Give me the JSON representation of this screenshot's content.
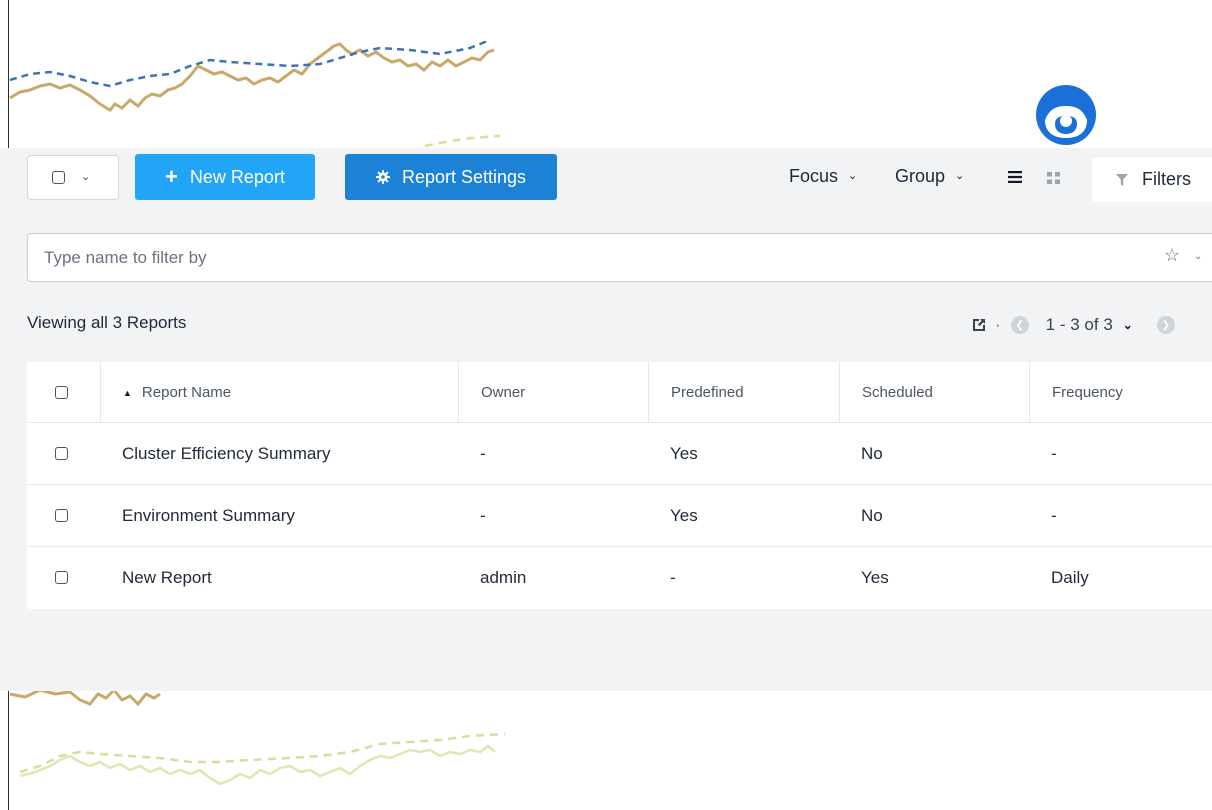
{
  "toolbar": {
    "new_report_label": "New Report",
    "report_settings_label": "Report Settings",
    "focus_label": "Focus",
    "group_label": "Group",
    "filters_label": "Filters"
  },
  "filter": {
    "placeholder": "Type name to filter by",
    "value": ""
  },
  "summary": {
    "viewing_text": "Viewing all 3 Reports",
    "pagination": "1 - 3 of 3",
    "separator": "·"
  },
  "table": {
    "columns": [
      "Report Name",
      "Owner",
      "Predefined",
      "Scheduled",
      "Frequency"
    ],
    "rows": [
      {
        "name": "Cluster Efficiency Summary",
        "owner": "-",
        "predefined": "Yes",
        "scheduled": "No",
        "frequency": "-"
      },
      {
        "name": "Environment Summary",
        "owner": "-",
        "predefined": "Yes",
        "scheduled": "No",
        "frequency": "-"
      },
      {
        "name": "New Report",
        "owner": "admin",
        "predefined": "-",
        "scheduled": "Yes",
        "frequency": "Daily"
      }
    ]
  },
  "icons": {
    "plus": "plus-icon",
    "gear": "gear-icon",
    "list_view": "list-view-icon",
    "grid_view": "grid-view-icon",
    "filter": "filter-icon",
    "star": "star-icon",
    "export": "export-icon",
    "avatar": "user-avatar-icon"
  },
  "colors": {
    "primary_button": "#22a5f7",
    "secondary_button": "#1b82d6",
    "panel_background": "#f2f3f5",
    "avatar_blue": "#1b6fd8"
  }
}
